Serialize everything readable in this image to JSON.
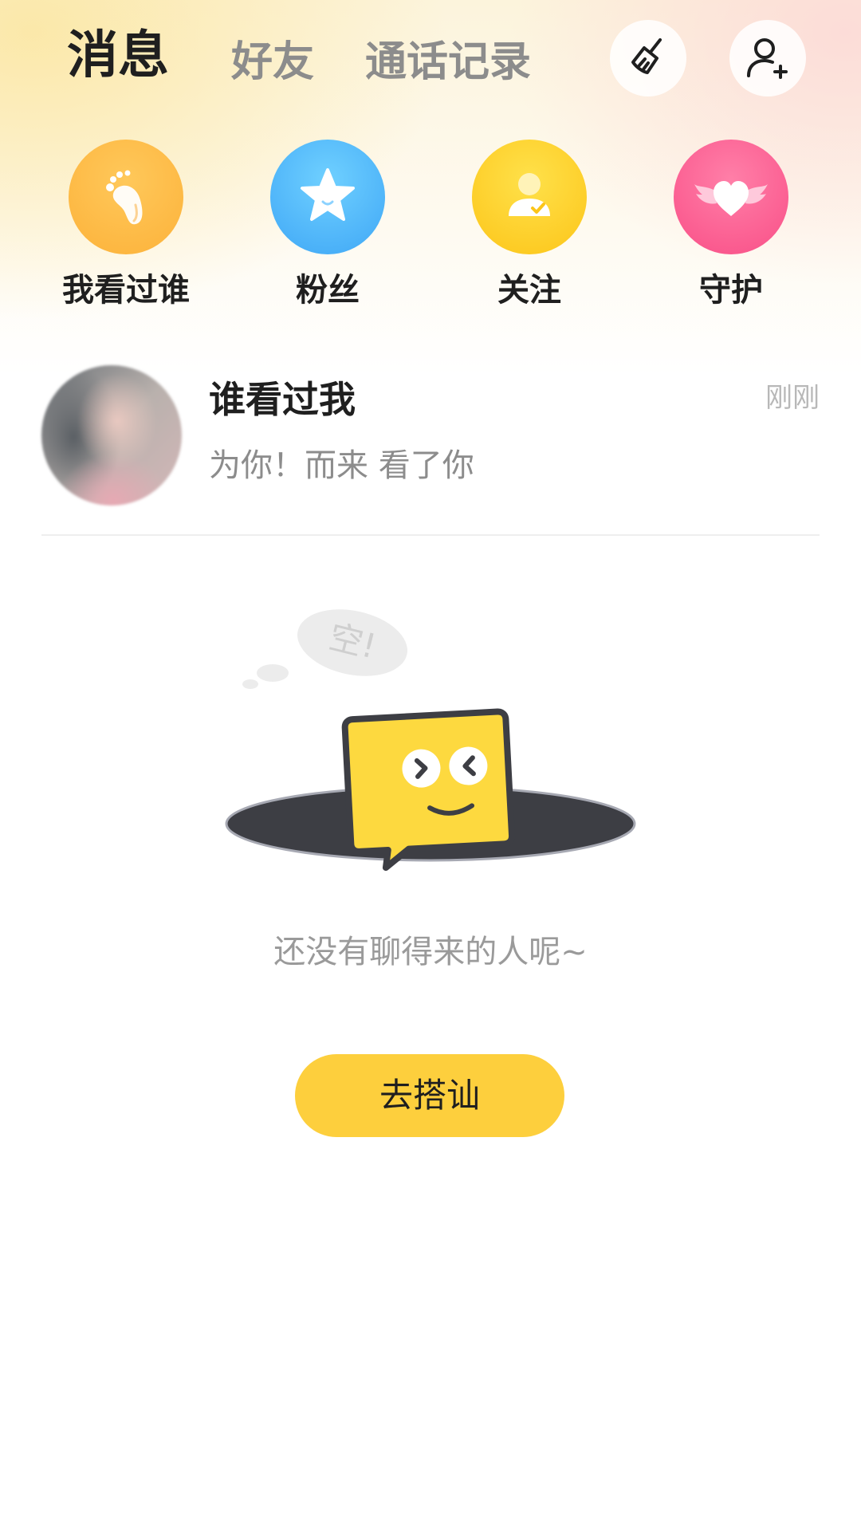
{
  "header": {
    "tabs": [
      {
        "label": "消息",
        "active": true
      },
      {
        "label": "好友",
        "active": false
      },
      {
        "label": "通话记录",
        "active": false
      }
    ],
    "actions": [
      {
        "icon": "broom-icon"
      },
      {
        "icon": "add-user-icon"
      }
    ]
  },
  "shortcuts": [
    {
      "label": "我看过谁",
      "icon": "footprint-icon",
      "color": "#fcb23a"
    },
    {
      "label": "粉丝",
      "icon": "star-icon",
      "color": "#3fa7f6"
    },
    {
      "label": "关注",
      "icon": "user-check-icon",
      "color": "#fcc519"
    },
    {
      "label": "守护",
      "icon": "winged-heart-icon",
      "color": "#f94f87"
    }
  ],
  "visitor": {
    "title": "谁看过我",
    "subtitle": "为你！而来 看了你",
    "time": "刚刚"
  },
  "empty_state": {
    "bubble_text": "空!",
    "message": "还没有聊得来的人呢~",
    "button_label": "去搭讪"
  },
  "colors": {
    "accent": "#fdcf3d",
    "text_primary": "#1f1f1f",
    "text_secondary": "#8c8c8c"
  }
}
